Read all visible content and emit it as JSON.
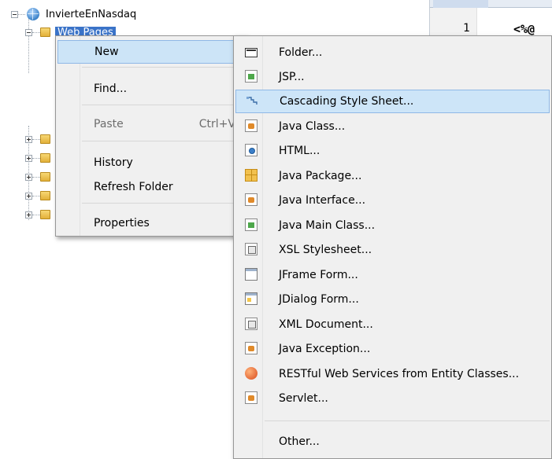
{
  "tree": {
    "project_label": "InvierteEnNasdaq",
    "selected_folder_label": "Web Pages"
  },
  "editor": {
    "line_number": "1",
    "code_text": "<%@"
  },
  "context_menu": {
    "items": [
      {
        "label": "New",
        "has_submenu": true,
        "state": "active"
      },
      {
        "label": "Find...",
        "has_submenu": false,
        "state": "normal"
      },
      {
        "label": "Paste",
        "shortcut": "Ctrl+V",
        "has_submenu": false,
        "state": "disabled"
      },
      {
        "label": "History",
        "has_submenu": true,
        "state": "normal"
      },
      {
        "label": "Refresh Folder",
        "has_submenu": false,
        "state": "normal"
      },
      {
        "label": "Properties",
        "has_submenu": false,
        "state": "normal"
      }
    ]
  },
  "submenu": {
    "items": [
      {
        "label": "Folder...",
        "icon": "folder-icon"
      },
      {
        "label": "JSP...",
        "icon": "jsp-file-icon"
      },
      {
        "label": "Cascading Style Sheet...",
        "icon": "css-file-icon",
        "state": "hover"
      },
      {
        "label": "Java Class...",
        "icon": "java-class-icon"
      },
      {
        "label": "HTML...",
        "icon": "html-file-icon"
      },
      {
        "label": "Java Package...",
        "icon": "java-package-icon"
      },
      {
        "label": "Java Interface...",
        "icon": "java-interface-icon"
      },
      {
        "label": "Java Main Class...",
        "icon": "java-main-class-icon"
      },
      {
        "label": "XSL Stylesheet...",
        "icon": "xsl-stylesheet-icon"
      },
      {
        "label": "JFrame Form...",
        "icon": "jframe-form-icon"
      },
      {
        "label": "JDialog Form...",
        "icon": "jdialog-form-icon"
      },
      {
        "label": "XML Document...",
        "icon": "xml-document-icon"
      },
      {
        "label": "Java Exception...",
        "icon": "java-exception-icon"
      },
      {
        "label": "RESTful Web Services from Entity Classes...",
        "icon": "restful-services-icon"
      },
      {
        "label": "Servlet...",
        "icon": "servlet-icon"
      },
      {
        "label": "Other...",
        "icon": ""
      }
    ]
  },
  "colors": {
    "menu_background": "#f0f0f0",
    "menu_highlight": "#cce4f7",
    "selection_blue": "#3a73c8"
  }
}
